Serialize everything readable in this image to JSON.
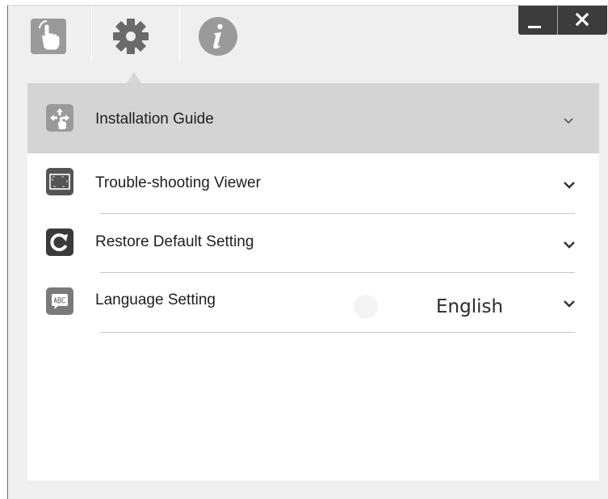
{
  "tabs": [
    {
      "icon": "hand-pointer-icon",
      "selected": false
    },
    {
      "icon": "gear-icon",
      "selected": true
    },
    {
      "icon": "info-icon",
      "selected": false
    }
  ],
  "window_controls": {
    "minimize_icon": "minimize-icon",
    "close_icon": "close-icon"
  },
  "settings": {
    "items": [
      {
        "label": "Installation Guide",
        "icon": "installation-guide-icon",
        "highlighted": true
      },
      {
        "label": "Trouble-shooting Viewer",
        "icon": "viewer-frame-icon"
      },
      {
        "label": "Restore Default Setting",
        "icon": "restore-icon"
      },
      {
        "label": "Language Setting",
        "icon": "abc-speech-bubble-icon",
        "value": "English"
      }
    ]
  },
  "colors": {
    "window_bg": "#efefef",
    "panel_bg": "#ffffff",
    "highlight_row": "#d4d4d4",
    "icon_gray": "#6a6a6a",
    "control_bar": "#3c3c3c"
  }
}
